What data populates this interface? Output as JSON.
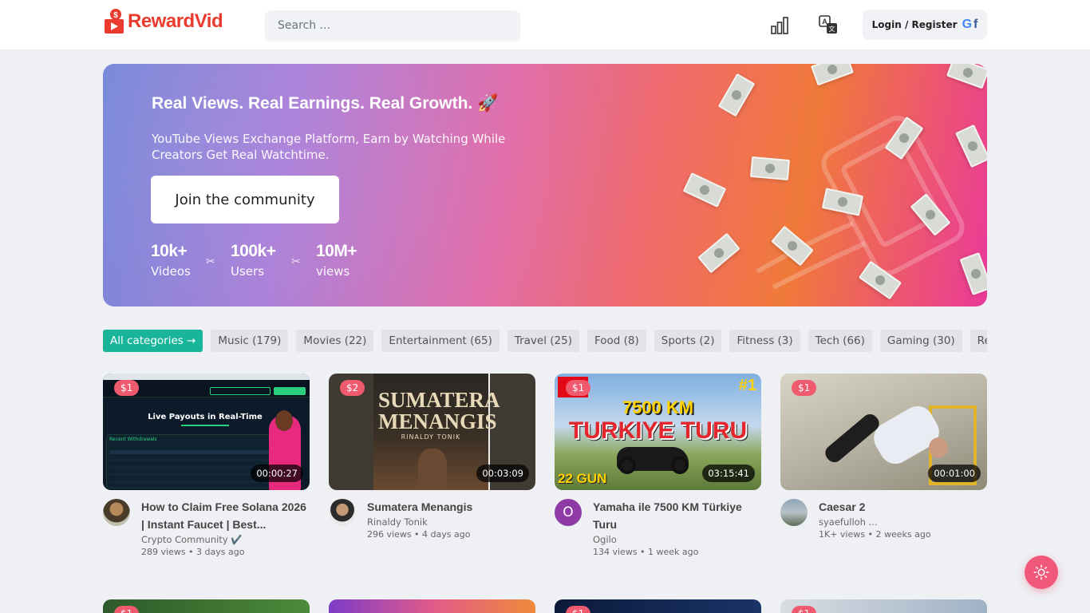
{
  "header": {
    "logo_text": "RewardVid",
    "search_placeholder": "Search ...",
    "login_label": "Login / Register",
    "brand_color": "#ea3b2e"
  },
  "hero": {
    "title": "Real Views. Real Earnings. Real Growth. 🚀",
    "subtitle": "YouTube Views Exchange Platform, Earn by Watching While Creators Get Real Watchtime.",
    "cta": "Join the community",
    "stats": [
      {
        "value": "10k+",
        "label": "Videos"
      },
      {
        "value": "100k+",
        "label": "Users"
      },
      {
        "value": "10M+",
        "label": "views"
      }
    ]
  },
  "categories": [
    {
      "label": "All categories →",
      "active": true
    },
    {
      "label": "Music (179)"
    },
    {
      "label": "Movies (22)"
    },
    {
      "label": "Entertainment (65)"
    },
    {
      "label": "Travel (25)"
    },
    {
      "label": "Food (8)"
    },
    {
      "label": "Sports (2)"
    },
    {
      "label": "Fitness (3)"
    },
    {
      "label": "Tech (66)"
    },
    {
      "label": "Gaming (30)"
    },
    {
      "label": "Real Esta"
    }
  ],
  "videos": [
    {
      "price": "$1",
      "duration": "00:00:27",
      "title": "How to Claim Free Solana 2026 | Instant Faucet | Best...",
      "channel": "Crypto Community ✔️",
      "stats": "289 views • 3 days ago",
      "thumb_text": "Live Payouts in Real-Time",
      "thumb_sub": "Recent Withdrawals"
    },
    {
      "price": "$2",
      "duration": "00:03:09",
      "title": "Sumatera Menangis",
      "channel": "Rinaldy Tonik",
      "stats": "296 views • 4 days ago",
      "thumb_text": "SUMATERA MENANGIS",
      "thumb_sub": "RINALDY TONIK"
    },
    {
      "price": "$1",
      "duration": "03:15:41",
      "title": "Yamaha ile 7500 KM Türkiye Turu",
      "channel": "Ogilo",
      "stats": "134 views • 1 week ago",
      "thumb_text": "7500 KM",
      "thumb_sub": "TURKIYE TURU",
      "avatar_letter": "O"
    },
    {
      "price": "$1",
      "duration": "00:01:00",
      "title": "Caesar 2",
      "channel": "syaefulloh ...",
      "stats": "1K+ views • 2 weeks ago"
    }
  ],
  "colors": {
    "accent_green": "#19b59a",
    "price_badge": "#ef5a6f",
    "theme_button": "#f0587a"
  },
  "icons": [
    "leaderboard-icon",
    "translate-icon",
    "google-icon",
    "facebook-icon",
    "sun-icon"
  ]
}
